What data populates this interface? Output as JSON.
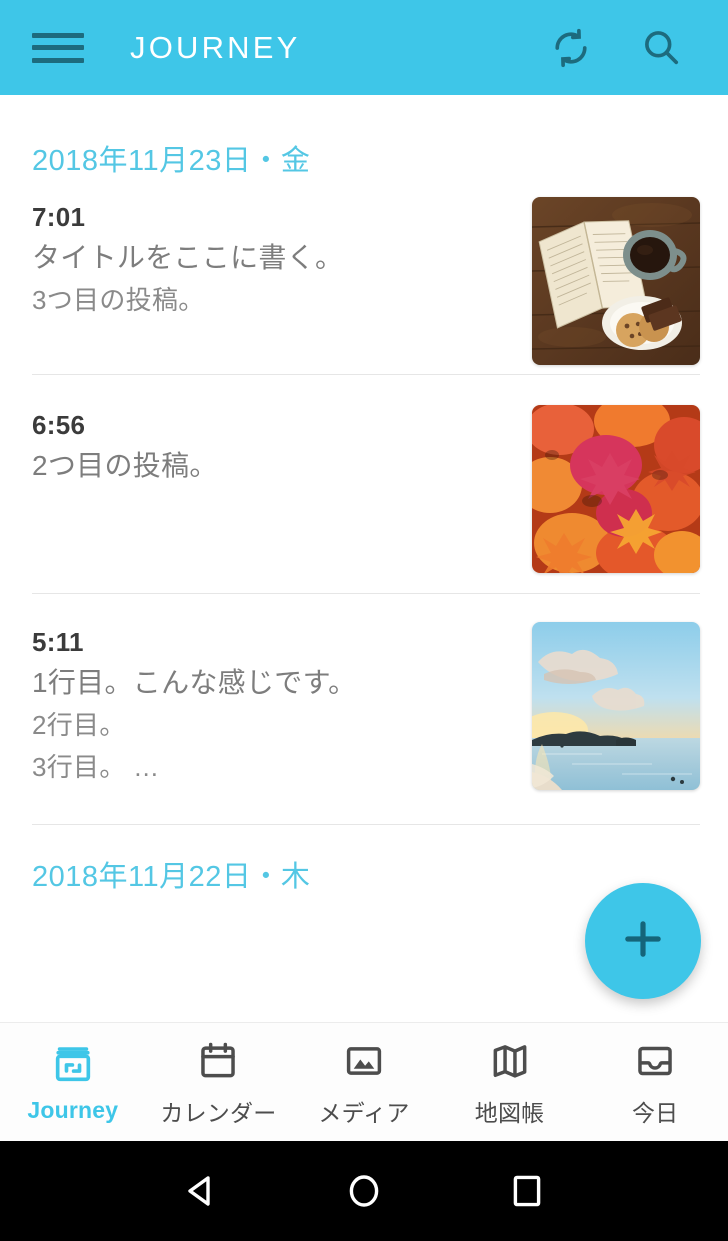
{
  "appbar": {
    "title": "JOURNEY",
    "menu_icon": "hamburger-menu-icon",
    "sync_icon": "sync-icon",
    "search_icon": "search-icon",
    "background_color": "#3ec6e8",
    "icon_color": "#1d6b7e",
    "title_color": "#ffffff"
  },
  "accent_color": "#3ec6e8",
  "date_color": "#54c7e4",
  "sections": [
    {
      "date": "2018年11月23日・金",
      "entries": [
        {
          "time": "7:01",
          "title": "タイトルをここに書く。",
          "lines": [
            "3つ目の投稿。"
          ],
          "thumbnail": "book-coffee-cookies-photo"
        },
        {
          "time": "6:56",
          "title": "2つ目の投稿。",
          "lines": [],
          "thumbnail": "autumn-maple-leaves-photo"
        },
        {
          "time": "5:11",
          "title": "1行目。こんな感じです。",
          "lines": [
            "2行目。",
            "3行目。 …"
          ],
          "thumbnail": "beach-sunset-photo"
        }
      ]
    },
    {
      "date": "2018年11月22日・木",
      "entries": []
    }
  ],
  "fab": {
    "label": "+",
    "icon": "plus-icon"
  },
  "bottom_nav": {
    "items": [
      {
        "label": "Journey",
        "icon": "journal-icon",
        "active": true
      },
      {
        "label": "カレンダー",
        "icon": "calendar-icon",
        "active": false
      },
      {
        "label": "メディア",
        "icon": "image-icon",
        "active": false
      },
      {
        "label": "地図帳",
        "icon": "map-icon",
        "active": false
      },
      {
        "label": "今日",
        "icon": "today-inbox-icon",
        "active": false
      }
    ]
  },
  "system_nav": {
    "back": "back-triangle-icon",
    "home": "home-circle-icon",
    "recents": "recents-square-icon"
  }
}
